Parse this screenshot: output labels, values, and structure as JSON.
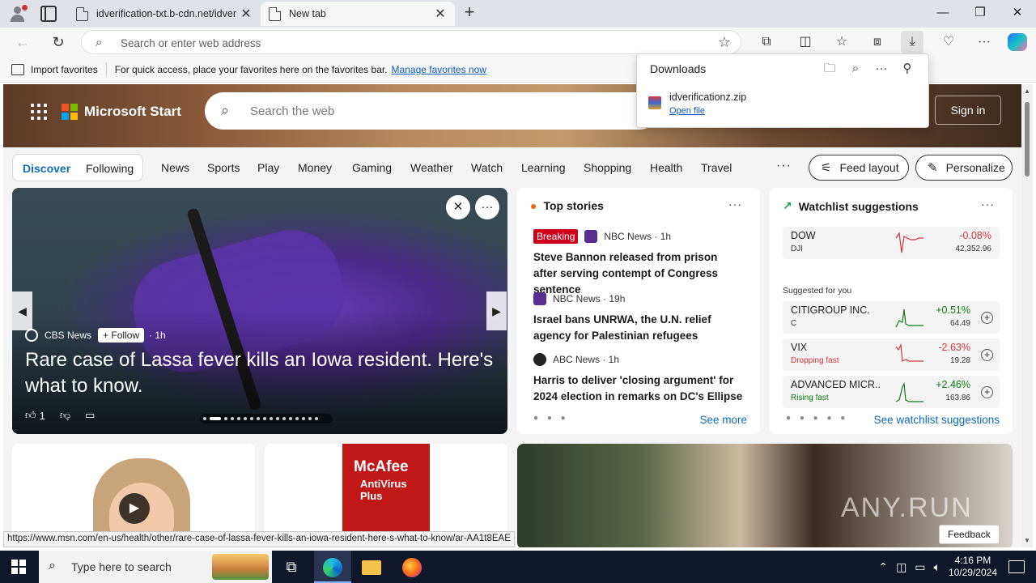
{
  "browser": {
    "tabs": [
      {
        "title": "idverification-txt.b-cdn.net/idver",
        "active": false
      },
      {
        "title": "New tab",
        "active": true
      }
    ],
    "address_placeholder": "Search or enter web address",
    "window_controls": [
      "—",
      "❐",
      "✕"
    ]
  },
  "favorites_bar": {
    "import_label": "Import favorites",
    "hint": "For quick access, place your favorites here on the favorites bar.",
    "manage_link": "Manage favorites now"
  },
  "downloads": {
    "title": "Downloads",
    "file_name": "idverificationz.zip",
    "open_label": "Open file"
  },
  "msn": {
    "brand": "Microsoft Start",
    "search_placeholder": "Search the web",
    "sign_in": "Sign in",
    "tabs": {
      "discover": "Discover",
      "following": "Following"
    },
    "categories": [
      "News",
      "Sports",
      "Play",
      "Money",
      "Gaming",
      "Weather",
      "Watch",
      "Learning",
      "Shopping",
      "Health",
      "Travel"
    ],
    "more": "···",
    "feed_layout": "Feed layout",
    "personalize": "Personalize",
    "feature": {
      "source": "CBS News",
      "follow": "+ Follow",
      "age": "· 1h",
      "headline": "Rare case of Lassa fever kills an Iowa resident. Here's what to know.",
      "likes": "1"
    },
    "top_stories": {
      "title": "Top stories",
      "items": [
        {
          "badge": "Breaking",
          "source": "NBC News · 1h",
          "headline": "Steve Bannon released from prison after serving contempt of Congress sentence"
        },
        {
          "badge": "",
          "source": "NBC News · 19h",
          "headline": "Israel bans UNRWA, the U.N. relief agency for Palestinian refugees"
        },
        {
          "badge": "",
          "source": "ABC News · 1h",
          "headline": "Harris to deliver 'closing argument' for 2024 election in remarks on DC's Ellipse"
        }
      ],
      "see_more": "See more"
    },
    "watchlist": {
      "title": "Watchlist suggestions",
      "suggested_label": "Suggested for you",
      "items": [
        {
          "name": "DOW",
          "sub": "DJI",
          "change": "-0.08%",
          "price": "42,352.96",
          "color": "#d13438"
        },
        {
          "name": "CITIGROUP INC.",
          "sub": "C",
          "change": "+0.51%",
          "price": "64.49",
          "color": "#107c10"
        },
        {
          "name": "VIX",
          "sub": "Dropping fast",
          "change": "-2.63%",
          "price": "19.28",
          "color": "#d13438"
        },
        {
          "name": "ADVANCED MICR...",
          "sub": "Rising fast",
          "change": "+2.46%",
          "price": "163.86",
          "color": "#107c10"
        }
      ],
      "see_link": "See watchlist suggestions"
    },
    "mcafee": {
      "brand": "McAfee",
      "product": "AntiVirus Plus"
    },
    "feedback": "Feedback",
    "watermark": "ANY.RUN"
  },
  "status_url": "https://www.msn.com/en-us/health/other/rare-case-of-lassa-fever-kills-an-iowa-resident-here-s-what-to-know/ar-AA1t8EAE",
  "taskbar": {
    "search_placeholder": "Type here to search",
    "time": "4:16 PM",
    "date": "10/29/2024"
  }
}
